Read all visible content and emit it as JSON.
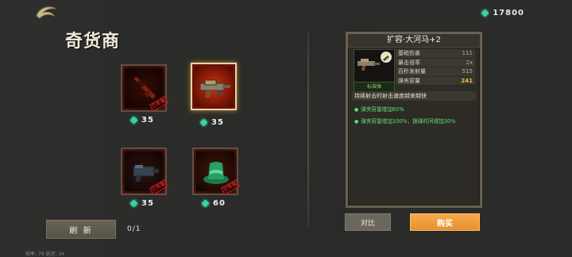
{
  "header": {
    "currency_amount": "17800"
  },
  "shop": {
    "title": "奇货商"
  },
  "items": [
    {
      "name": "rifle",
      "price": "35",
      "stamp": "已售罄",
      "selected": false
    },
    {
      "name": "hippo-gun",
      "price": "35",
      "stamp": "",
      "selected": true
    },
    {
      "name": "blaster",
      "price": "35",
      "stamp": "已售罄",
      "selected": false
    },
    {
      "name": "green-hat",
      "price": "60",
      "stamp": "已售罄",
      "selected": false
    }
  ],
  "refresh": {
    "label": "刷 新",
    "count": "0/1"
  },
  "detail": {
    "title": "扩容·大河马+2",
    "type_badge": "标准弹",
    "stats": [
      {
        "label": "基础伤害",
        "value": "111"
      },
      {
        "label": "暴击倍率",
        "value": "2x"
      },
      {
        "label": "百秒发射量",
        "value": "515"
      },
      {
        "label": "弹夹容量",
        "value": "241"
      }
    ],
    "description": "持续射击时射击速度越来越快",
    "perks": [
      "弹夹容量增加60%",
      "弹夹容量增加100%，换弹时间增加30%"
    ]
  },
  "actions": {
    "compare": "对比",
    "buy": "购买"
  },
  "debug": {
    "fps": "帧率: 79   延迟: 34"
  },
  "colors": {
    "accent_gem": "#3dd0a8",
    "buy_button": "#f0a040",
    "highlight_value": "#f3c23a",
    "perk_text": "#5ee07a"
  }
}
